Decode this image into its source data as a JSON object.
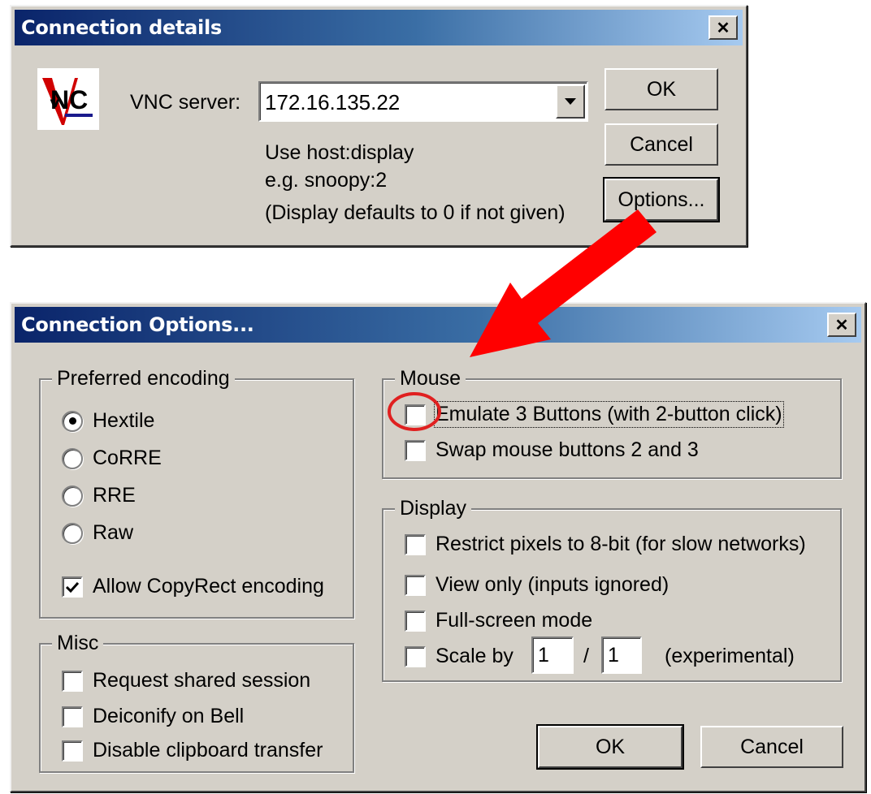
{
  "connection_details": {
    "title": "Connection details",
    "server_label": "VNC server:",
    "server_value": "172.16.135.22",
    "hint_line1": "Use host:display",
    "hint_line2": "e.g. snoopy:2",
    "hint_line3": "(Display defaults to 0 if not given)",
    "ok_label": "OK",
    "cancel_label": "Cancel",
    "options_label": "Options...",
    "close_glyph": "✕"
  },
  "connection_options": {
    "title": "Connection Options...",
    "close_glyph": "✕",
    "encoding": {
      "legend": "Preferred encoding",
      "options": [
        "Hextile",
        "CoRRE",
        "RRE",
        "Raw"
      ],
      "selected": "Hextile",
      "copyrect_label": "Allow CopyRect encoding",
      "copyrect_checked": true
    },
    "misc": {
      "legend": "Misc",
      "items": [
        "Request shared session",
        "Deiconify on Bell",
        "Disable clipboard transfer"
      ]
    },
    "mouse": {
      "legend": "Mouse",
      "items": [
        "Emulate 3 Buttons (with 2-button click)",
        "Swap mouse buttons 2 and 3"
      ]
    },
    "display": {
      "legend": "Display",
      "items": [
        "Restrict pixels to 8-bit (for slow networks)",
        "View only (inputs ignored)",
        "Full-screen mode"
      ],
      "scale_label": "Scale by",
      "scale_num": "1",
      "scale_sep": "/",
      "scale_den": "1",
      "scale_note": "(experimental)"
    },
    "ok_label": "OK",
    "cancel_label": "Cancel"
  },
  "annotation": {
    "arrow_color": "#ff0000",
    "highlight_color": "#e02020"
  },
  "icons": {
    "logo": "vnc-logo-icon",
    "dropdown": "chevron-down-icon",
    "close": "close-icon",
    "check": "check-icon"
  }
}
